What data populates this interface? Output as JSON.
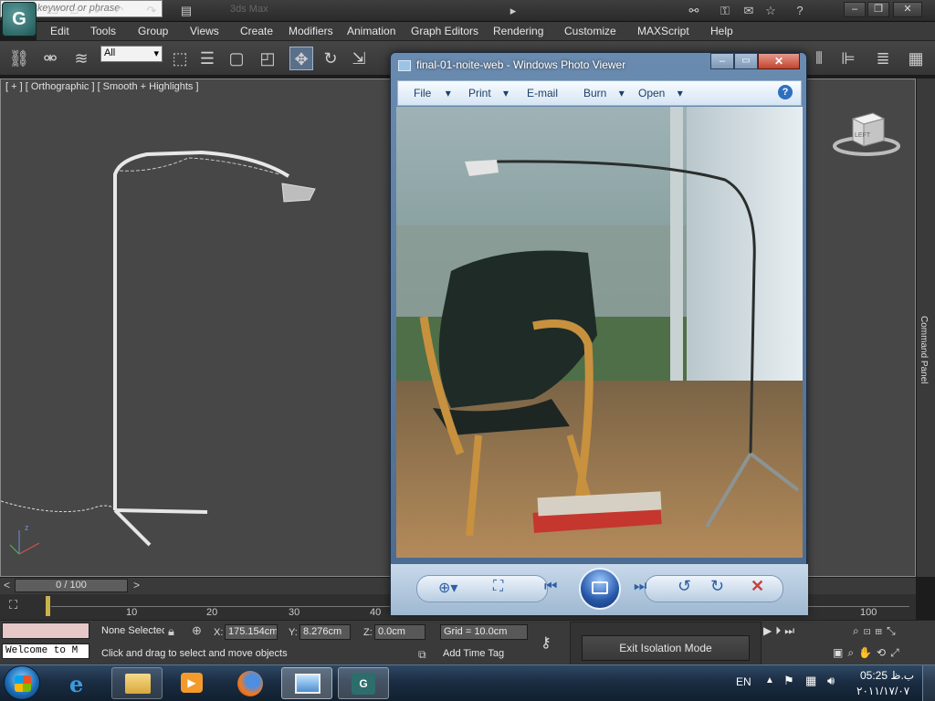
{
  "app": {
    "title_fragment": "3ds Max",
    "search_placeholder": "Type a keyword or phrase",
    "menu": [
      "Edit",
      "Tools",
      "Group",
      "Views",
      "Create",
      "Modifiers",
      "Animation",
      "Graph Editors",
      "Rendering",
      "Customize",
      "MAXScript",
      "Help"
    ],
    "selection_filter": "All",
    "viewport_label": "[ + ] [ Orthographic ] [ Smooth + Highlights ]",
    "command_panel_label": "Command Panel",
    "viewcube_label": "LEFT",
    "frame_counter": "0 / 100",
    "ticks": [
      "10",
      "20",
      "30",
      "40",
      "100"
    ],
    "status": {
      "selection": "None Selectec",
      "x_label": "X:",
      "x_value": "175.154cm",
      "y_label": "Y:",
      "y_value": "8.276cm",
      "z_label": "Z:",
      "z_value": "0.0cm",
      "grid": "Grid = 10.0cm",
      "prompt": "Click and drag to select and move objects",
      "add_time_tag": "Add Time Tag",
      "welcome": "Welcome to M",
      "isolation_button": "Exit Isolation Mode"
    }
  },
  "photo_viewer": {
    "title": "final-01-noite-web - Windows Photo Viewer",
    "menu": [
      "File",
      "Print",
      "E-mail",
      "Burn",
      "Open"
    ]
  },
  "taskbar": {
    "language": "EN",
    "time": "05:25 ب.ظ",
    "date": "۲۰۱۱/۱۷/۰۷"
  },
  "colors": {
    "viewport_bg": "#474747",
    "accent_blue": "#3c6fb0",
    "close_red": "#c9403a"
  }
}
